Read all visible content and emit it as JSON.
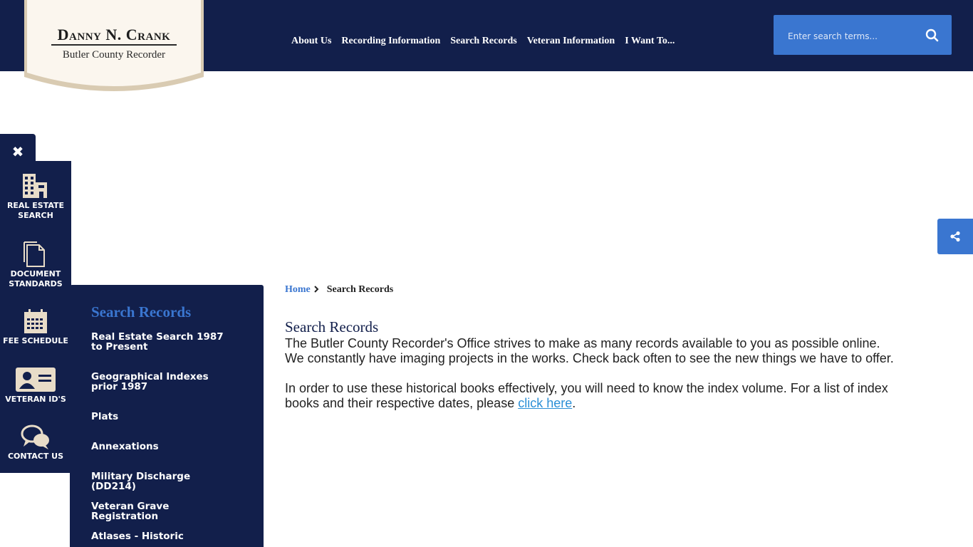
{
  "header": {
    "logo": {
      "name": "Danny N. Crank",
      "title": "Butler County Recorder"
    },
    "nav": [
      {
        "label": "About Us"
      },
      {
        "label": "Recording Information"
      },
      {
        "label": "Search Records"
      },
      {
        "label": "Veteran Information"
      },
      {
        "label": "I Want To..."
      }
    ],
    "search": {
      "placeholder": "Enter search terms...",
      "button_icon": "search-icon"
    }
  },
  "quick_links": {
    "close_icon": "close-icon",
    "items": [
      {
        "label": "Real Estate Search",
        "icon": "buildings-icon"
      },
      {
        "label": "Document Standards",
        "icon": "document-icon"
      },
      {
        "label": "Fee Schedule",
        "icon": "calendar-icon"
      },
      {
        "label": "Veteran ID's",
        "icon": "id-card-icon"
      },
      {
        "label": "Contact Us",
        "icon": "chat-bubbles-icon"
      }
    ]
  },
  "subnav": {
    "title": "Search Records",
    "links": [
      {
        "label": "Real Estate Search 1987 to Present"
      },
      {
        "label": "Geographical Indexes prior 1987"
      },
      {
        "label": "Plats"
      },
      {
        "label": "Annexations"
      },
      {
        "label": "Military Discharge (DD214)"
      },
      {
        "label": "Veteran Grave Registration"
      },
      {
        "label": "Atlases - Historic"
      }
    ]
  },
  "breadcrumb": {
    "home": "Home",
    "current": "Search Records"
  },
  "main": {
    "title": "Search Records",
    "paragraph1": "The Butler County Recorder's Office strives to make as many records available to you as possible online.  We constantly have imaging projects in the works.  Check back often to see the new things we have to offer.",
    "paragraph2_before": "In order to use these historical books effectively, you will need to know the index volume. For a list of index books and their respective dates, please ",
    "paragraph2_link": "click here",
    "paragraph2_after": "."
  },
  "share": {
    "icon": "share-icon"
  },
  "colors": {
    "navy": "#121f4b",
    "accent_blue": "#3a76d0",
    "link_blue": "#2b8fd6",
    "logo_cream": "#fbf6ee",
    "icon_tan": "#e8dcc8"
  }
}
